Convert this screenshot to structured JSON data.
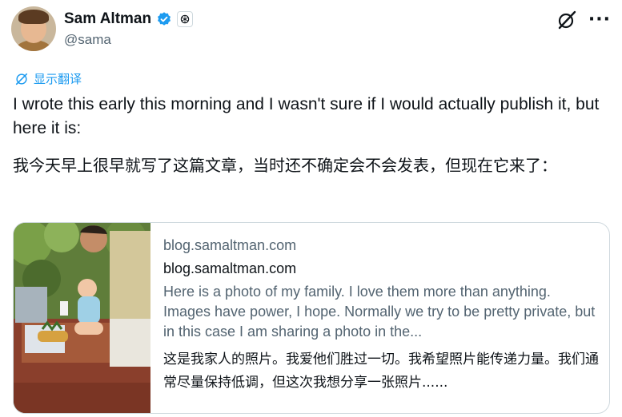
{
  "author": {
    "name": "Sam Altman",
    "handle": "@sama",
    "verified_color": "#1d9bf0"
  },
  "translate_label": "显示翻译",
  "tweet": {
    "text_en": "I wrote this early this morning and I wasn't sure if I would actually publish it, but here it is:",
    "text_cn": "我今天早上很早就写了这篇文章，当时还不确定会不会发表，但现在它来了："
  },
  "link_card": {
    "domain": "blog.samaltman.com",
    "title": "blog.samaltman.com",
    "description": "Here is a photo of my family. I love them more than anything. Images have power, I hope. Normally we try to be pretty private, but in this case I am sharing a photo in the...",
    "description_cn": "这是我家人的照片。我爱他们胜过一切。我希望照片能传递力量。我们通常尽量保持低调，但这次我想分享一张照片......"
  },
  "colors": {
    "link": "#1d9bf0",
    "secondary_text": "#536471",
    "primary_text": "#0f1419",
    "border": "#cfd9de"
  },
  "icons": [
    "verified-badge-icon",
    "openai-affiliate-icon",
    "grok-icon",
    "more-icon",
    "translate-icon"
  ]
}
